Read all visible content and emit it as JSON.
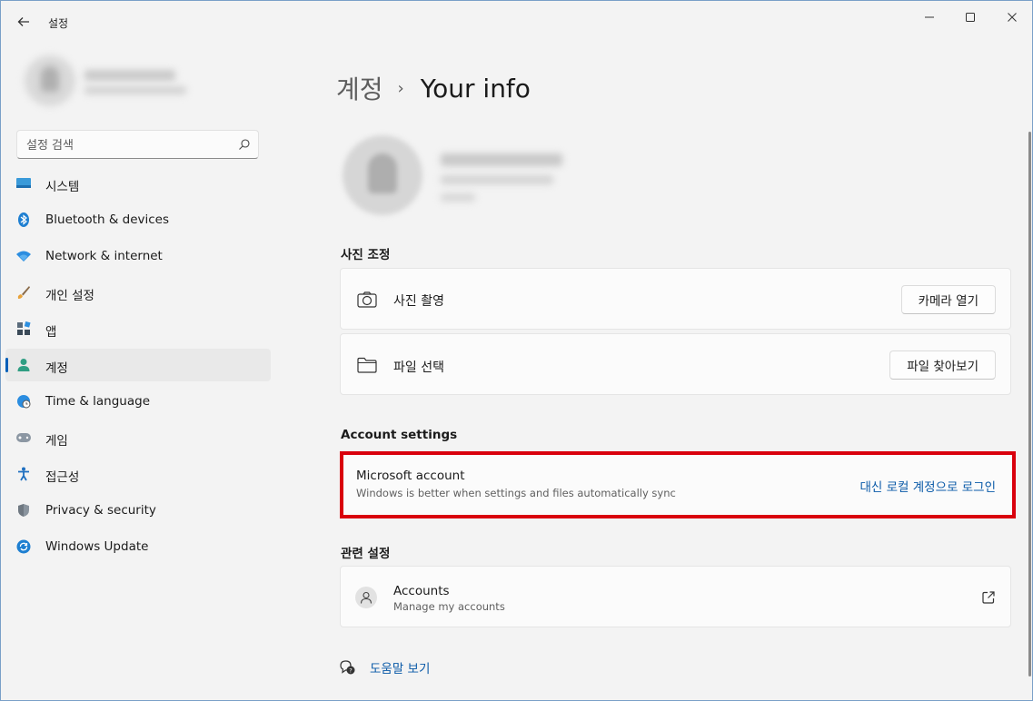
{
  "window": {
    "app_title": "설정",
    "controls": {
      "minimize": "minimize-icon",
      "maximize": "maximize-icon",
      "close": "close-icon"
    }
  },
  "search": {
    "placeholder": "설정 검색"
  },
  "nav": {
    "items": [
      {
        "label": "시스템",
        "icon": "system-icon",
        "active": false
      },
      {
        "label": "Bluetooth & devices",
        "icon": "bluetooth-icon",
        "active": false
      },
      {
        "label": "Network & internet",
        "icon": "wifi-icon",
        "active": false
      },
      {
        "label": "개인 설정",
        "icon": "brush-icon",
        "active": false
      },
      {
        "label": "앱",
        "icon": "apps-icon",
        "active": false
      },
      {
        "label": "계정",
        "icon": "account-icon",
        "active": true
      },
      {
        "label": "Time & language",
        "icon": "globe-clock-icon",
        "active": false
      },
      {
        "label": "게임",
        "icon": "gamepad-icon",
        "active": false
      },
      {
        "label": "접근성",
        "icon": "accessibility-icon",
        "active": false
      },
      {
        "label": "Privacy & security",
        "icon": "shield-icon",
        "active": false
      },
      {
        "label": "Windows Update",
        "icon": "update-icon",
        "active": false
      }
    ]
  },
  "breadcrumb": {
    "parent": "계정",
    "separator": "›",
    "current": "Your info"
  },
  "photo_section": {
    "title": "사진 조정",
    "take_photo": {
      "label": "사진 촬영",
      "button": "카메라 열기"
    },
    "choose_file": {
      "label": "파일 선택",
      "button": "파일 찾아보기"
    }
  },
  "account_settings": {
    "title": "Account settings",
    "microsoft_account": {
      "title": "Microsoft account",
      "subtitle": "Windows is better when settings and files automatically sync",
      "link": "대신 로컬 계정으로 로그인"
    }
  },
  "related": {
    "title": "관련 설정",
    "accounts": {
      "title": "Accounts",
      "subtitle": "Manage my accounts"
    }
  },
  "help": {
    "label": "도움말 보기"
  },
  "colors": {
    "accent": "#005fb8",
    "link": "#0a5aa8",
    "highlight": "#d9000d"
  }
}
